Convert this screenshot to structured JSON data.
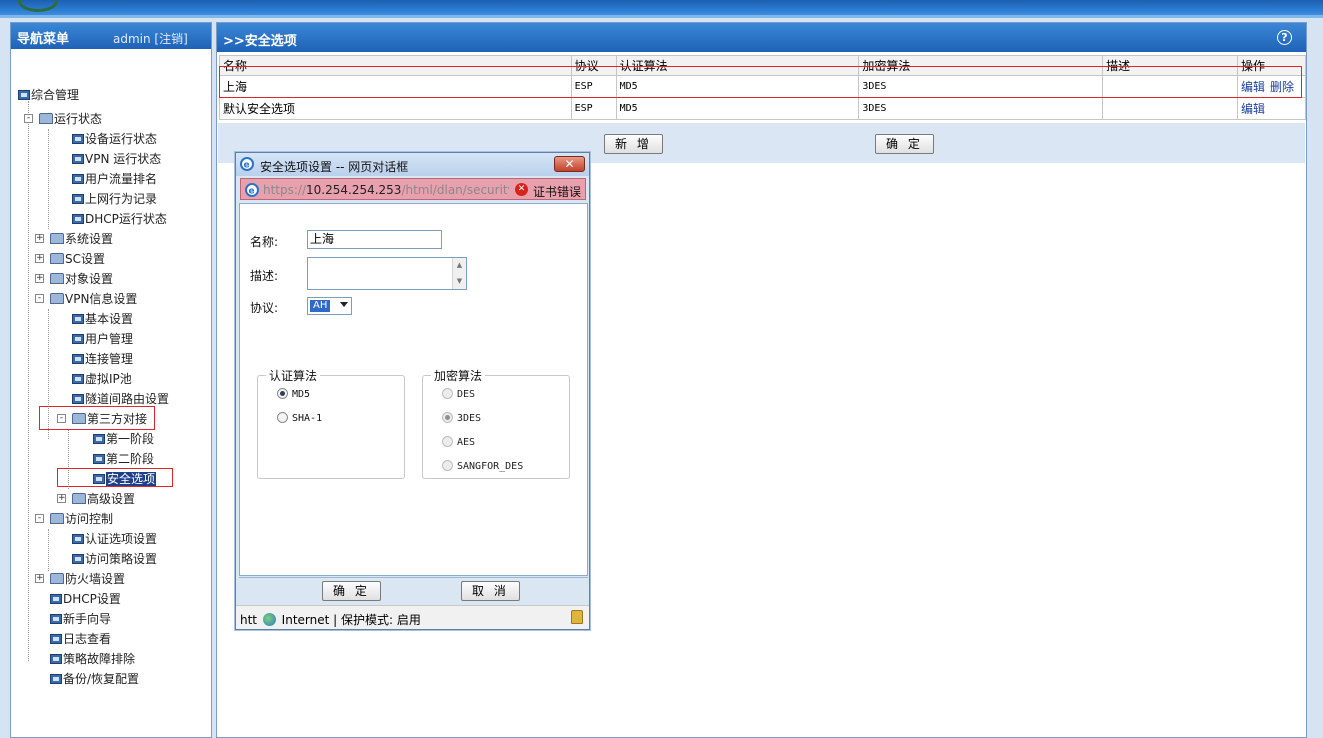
{
  "nav": {
    "title": "导航菜单",
    "user": "admin [注销]",
    "items": [
      {
        "label": "综合管理"
      },
      {
        "label": "运行状态"
      },
      {
        "label": "设备运行状态"
      },
      {
        "label": "VPN 运行状态"
      },
      {
        "label": "用户流量排名"
      },
      {
        "label": "上网行为记录"
      },
      {
        "label": "DHCP运行状态"
      },
      {
        "label": "系统设置"
      },
      {
        "label": "SC设置"
      },
      {
        "label": "对象设置"
      },
      {
        "label": "VPN信息设置"
      },
      {
        "label": "基本设置"
      },
      {
        "label": "用户管理"
      },
      {
        "label": "连接管理"
      },
      {
        "label": "虚拟IP池"
      },
      {
        "label": "隧道间路由设置"
      },
      {
        "label": "第三方对接"
      },
      {
        "label": "第一阶段"
      },
      {
        "label": "第二阶段"
      },
      {
        "label": "安全选项"
      },
      {
        "label": "高级设置"
      },
      {
        "label": "访问控制"
      },
      {
        "label": "认证选项设置"
      },
      {
        "label": "访问策略设置"
      },
      {
        "label": "防火墙设置"
      },
      {
        "label": "DHCP设置"
      },
      {
        "label": "新手向导"
      },
      {
        "label": "日志查看"
      },
      {
        "label": "策略故障排除"
      },
      {
        "label": "备份/恢复配置"
      }
    ]
  },
  "main": {
    "title": ">>安全选项",
    "columns": [
      "名称",
      "协议",
      "认证算法",
      "加密算法",
      "描述",
      "操作"
    ],
    "rows": [
      {
        "name": "上海",
        "protocol": "ESP",
        "auth": "MD5",
        "enc": "3DES",
        "desc": "",
        "edit": "编辑",
        "delete": "删除"
      },
      {
        "name": "默认安全选项",
        "protocol": "ESP",
        "auth": "MD5",
        "enc": "3DES",
        "desc": "",
        "edit": "编辑"
      }
    ],
    "add_button": "新 增",
    "ok_button": "确 定"
  },
  "dialog": {
    "title": "安全选项设置 -- 网页对话框",
    "url_prefix": "https://",
    "url_host": "10.254.254.253",
    "url_path": "/html/dlan/security_",
    "cert_error": "证书错误",
    "name_label": "名称:",
    "name_value": "上海",
    "desc_label": "描述:",
    "protocol_label": "协议:",
    "protocol_value": "AH",
    "auth_group": "认证算法",
    "auth_options": [
      "MD5",
      "SHA-1"
    ],
    "auth_selected": "MD5",
    "enc_group": "加密算法",
    "enc_options": [
      "DES",
      "3DES",
      "AES",
      "SANGFOR_DES"
    ],
    "enc_selected": "3DES",
    "ok_button": "确 定",
    "cancel_button": "取 消",
    "status_prefix": "htt",
    "status_zone": "Internet | 保护模式: 启用"
  },
  "colors": {
    "header_blue": "#1e62b6",
    "highlight_red": "#e0262c",
    "link_blue": "#1a3f9e"
  }
}
